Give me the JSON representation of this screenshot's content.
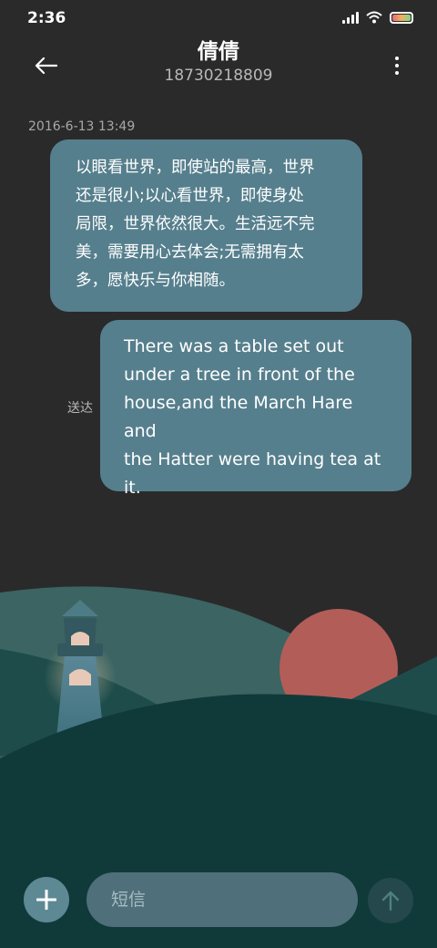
{
  "status_bar": {
    "time": "2:36",
    "icons": [
      "signal-icon",
      "wifi-icon",
      "battery-icon"
    ]
  },
  "header": {
    "contact_name": "倩倩",
    "contact_number": "18730218809",
    "back_icon": "arrow-left-icon",
    "more_icon": "more-vertical-icon"
  },
  "conversation": {
    "timestamp": "2016-6-13 13:49",
    "messages": [
      {
        "direction": "incoming",
        "lines": [
          "以眼看世界，即使站的最高，世界",
          "还是很小;以心看世界，即使身处",
          "局限，世界依然很大。生活远不完",
          "美，需要用心去体会;无需拥有太",
          "多，愿快乐与你相随。"
        ]
      },
      {
        "direction": "outgoing",
        "status": "送达",
        "lines": [
          "There was a table set out",
          "under a tree in front of the",
          "house,and the March Hare and",
          "the Hatter were having tea at",
          "it."
        ]
      }
    ]
  },
  "composer": {
    "placeholder": "短信",
    "add_icon": "plus-icon",
    "send_icon": "arrow-up-icon"
  },
  "colors": {
    "background": "#2a2a2a",
    "bubble": "#567f8d",
    "input": "#4f6f7a",
    "hill_dark": "#103a3a",
    "sun": "#b35d58"
  }
}
